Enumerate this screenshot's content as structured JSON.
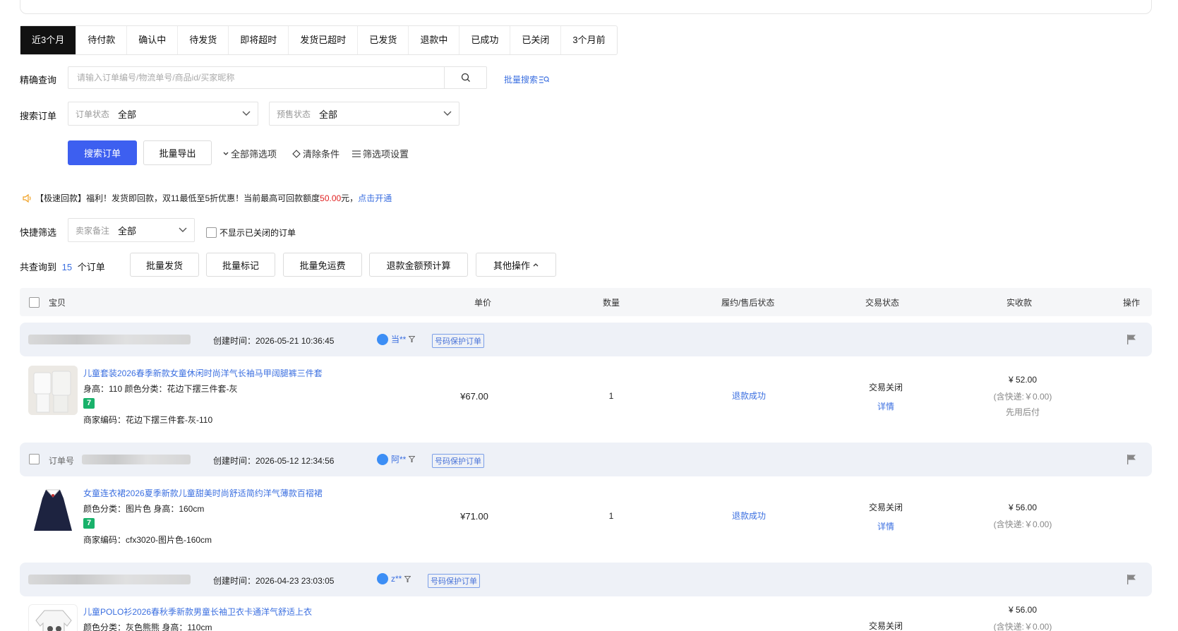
{
  "tabs": [
    "近3个月",
    "待付款",
    "确认中",
    "待发货",
    "即将超时",
    "发货已超时",
    "已发货",
    "退款中",
    "已成功",
    "已关闭",
    "3个月前"
  ],
  "search": {
    "label": "精确查询",
    "placeholder": "请输入订单编号/物流单号/商品id/买家昵称",
    "batch_search": "批量搜索"
  },
  "filters": {
    "label": "搜索订单",
    "order_status": {
      "label": "订单状态",
      "value": "全部"
    },
    "presale_status": {
      "label": "预售状态",
      "value": "全部"
    }
  },
  "actions": {
    "search_orders": "搜索订单",
    "batch_export": "批量导出",
    "all_filters": "全部筛选项",
    "clear_conditions": "清除条件",
    "filter_settings": "筛选项设置"
  },
  "notice": {
    "text_before": "【极速回款】福利！发货即回款，双11最低至5折优惠！当前最高可回款额度",
    "amount": "50.00",
    "text_after": "元，",
    "link": "点击开通"
  },
  "quick_filter": {
    "label": "快捷筛选",
    "seller_note": {
      "label": "卖家备注",
      "value": "全部"
    },
    "hide_closed": "不显示已关闭的订单"
  },
  "summary": {
    "prefix": "共查询到",
    "count": "15",
    "suffix": "个订单"
  },
  "bulk_buttons": {
    "ship": "批量发货",
    "mark": "批量标记",
    "free_shipping": "批量免运费",
    "refund_calc": "退款金额预计算",
    "other": "其他操作"
  },
  "table_headers": {
    "item": "宝贝",
    "price": "单价",
    "quantity": "数量",
    "fulfillment": "履约/售后状态",
    "trade_status": "交易状态",
    "received": "实收款",
    "operation": "操作"
  },
  "orders": [
    {
      "created": "创建时间：2026-05-21 10:36:45",
      "buyer": "当**",
      "tag": "号码保护订单",
      "title": "儿童套装2026春季新款女童休闲时尚洋气长袖马甲阔腿裤三件套",
      "attrs": "身高：110   颜色分类：花边下摆三件套-灰",
      "badge": "7",
      "sku": "商家编码：花边下摆三件套-灰-110",
      "price": "¥67.00",
      "qty": "1",
      "fulfillment": "退款成功",
      "trade": "交易关闭",
      "detail": "详情",
      "received": "¥ 52.00",
      "shipping": "(含快递:￥0.00)",
      "pay_note": "先用后付"
    },
    {
      "order_no_label": "订单号",
      "created": "创建时间：2026-05-12 12:34:56",
      "buyer": "阿**",
      "tag": "号码保护订单",
      "title": "女童连衣裙2026夏季新款儿童甜美时尚舒适简约洋气薄款百褶裙",
      "attrs": "颜色分类：图片色   身高：160cm",
      "badge": "7",
      "sku": "商家编码：cfx3020-图片色-160cm",
      "price": "¥71.00",
      "qty": "1",
      "fulfillment": "退款成功",
      "trade": "交易关闭",
      "detail": "详情",
      "received": "¥ 56.00",
      "shipping": "(含快递:￥0.00)"
    },
    {
      "created": "创建时间：2026-04-23 23:03:05",
      "buyer": "z**",
      "tag": "号码保护订单",
      "title": "儿童POLO衫2026春秋季新款男童长袖卫衣卡通洋气舒适上衣",
      "attrs": "颜色分类：灰色熊熊   身高：110cm",
      "trade": "交易关闭",
      "received": "¥ 56.00",
      "shipping": "(含快递:￥0.00)"
    }
  ]
}
